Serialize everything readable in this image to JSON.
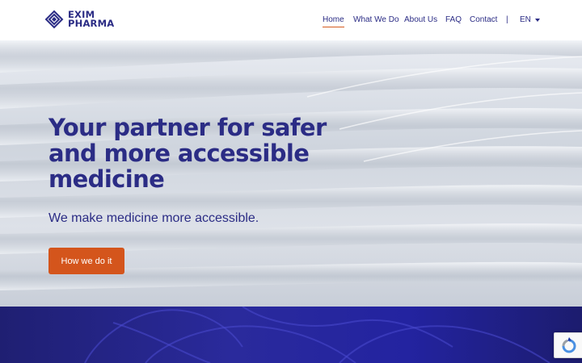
{
  "brand": {
    "line1": "EXIM",
    "line2": "PHARMA",
    "color": "#2b2c85",
    "icon": "exim-logo-icon"
  },
  "nav": {
    "items": [
      {
        "label": "Home",
        "active": true
      },
      {
        "label": "What We Do"
      },
      {
        "label": "About Us"
      },
      {
        "label": "FAQ"
      },
      {
        "label": "Contact"
      }
    ],
    "separator": "|",
    "language": "EN"
  },
  "hero": {
    "title": "Your partner for safer and more accessible medicine",
    "subtitle": "We make medicine more accessible.",
    "button": "How we do it",
    "button_color": "#d4551c"
  },
  "recaptcha": {
    "icon": "recaptcha-icon"
  }
}
